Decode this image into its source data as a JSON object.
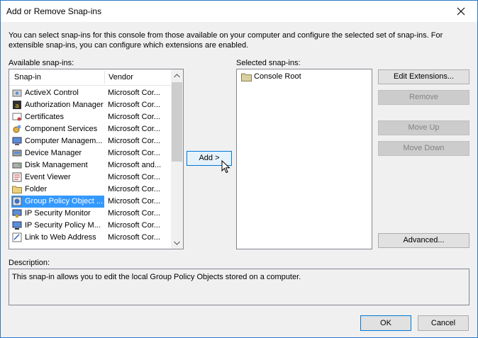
{
  "window": {
    "title": "Add or Remove Snap-ins"
  },
  "intro_text": "You can select snap-ins for this console from those available on your computer and configure the selected set of snap-ins. For extensible snap-ins, you can configure which extensions are enabled.",
  "available": {
    "label": "Available snap-ins:",
    "columns": {
      "snapin": "Snap-in",
      "vendor": "Vendor"
    },
    "items": [
      {
        "name": "ActiveX Control",
        "vendor": "Microsoft Cor...",
        "icon": "activex-icon"
      },
      {
        "name": "Authorization Manager",
        "vendor": "Microsoft Cor...",
        "icon": "authorization-icon"
      },
      {
        "name": "Certificates",
        "vendor": "Microsoft Cor...",
        "icon": "certificate-icon"
      },
      {
        "name": "Component Services",
        "vendor": "Microsoft Cor...",
        "icon": "component-icon"
      },
      {
        "name": "Computer Managem...",
        "vendor": "Microsoft Cor...",
        "icon": "computer-icon"
      },
      {
        "name": "Device Manager",
        "vendor": "Microsoft Cor...",
        "icon": "device-icon"
      },
      {
        "name": "Disk Management",
        "vendor": "Microsoft and...",
        "icon": "disk-icon"
      },
      {
        "name": "Event Viewer",
        "vendor": "Microsoft Cor...",
        "icon": "event-icon"
      },
      {
        "name": "Folder",
        "vendor": "Microsoft Cor...",
        "icon": "folder-icon"
      },
      {
        "name": "Group Policy Object ...",
        "vendor": "Microsoft Cor...",
        "icon": "policy-icon",
        "selected": true
      },
      {
        "name": "IP Security Monitor",
        "vendor": "Microsoft Cor...",
        "icon": "ipsec-monitor-icon"
      },
      {
        "name": "IP Security Policy M...",
        "vendor": "Microsoft Cor...",
        "icon": "ipsec-policy-icon"
      },
      {
        "name": "Link to Web Address",
        "vendor": "Microsoft Cor...",
        "icon": "link-icon"
      }
    ]
  },
  "buttons": {
    "add": "Add >",
    "edit_extensions": "Edit Extensions...",
    "remove": "Remove",
    "move_up": "Move Up",
    "move_down": "Move Down",
    "advanced": "Advanced...",
    "ok": "OK",
    "cancel": "Cancel"
  },
  "selected": {
    "label": "Selected snap-ins:",
    "items": [
      {
        "name": "Console Root",
        "icon": "folder-icon"
      }
    ]
  },
  "description": {
    "label": "Description:",
    "text": "This snap-in allows you to edit the local Group Policy Objects stored on a computer."
  },
  "colors": {
    "selection": "#3399ff",
    "accent_border": "#0078d7",
    "window_border": "#2b79c8"
  }
}
